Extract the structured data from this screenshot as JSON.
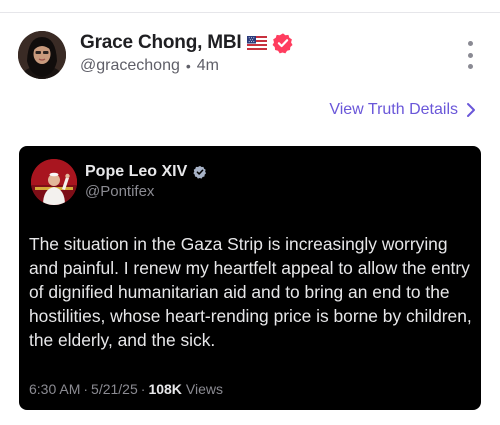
{
  "post": {
    "author_name": "Grace Chong, MBI",
    "flag_emoji": "us-flag-icon",
    "verified_icon": "verified-badge-icon",
    "handle": "@gracechong",
    "separator": "•",
    "age": "4m",
    "more_icon": "more-vertical-icon"
  },
  "truth_link": {
    "label": "View Truth Details",
    "icon": "chevron-right-icon",
    "color": "#6a57d9"
  },
  "embedded": {
    "author_name": "Pope Leo XIV",
    "handle": "@Pontifex",
    "verified_icon": "verified-badge-icon",
    "text": "The situation in the Gaza Strip is increasingly worrying and painful. I renew my heartfelt appeal to allow the entry of dignified humanitarian aid and to bring an end to the hostilities, whose heart-rending price is borne by children, the elderly, and the sick.",
    "time": "6:30 AM",
    "date": "5/21/25",
    "sep": "·",
    "views_count": "108K",
    "views_label": "Views"
  },
  "colors": {
    "verified": "#ff3d5f",
    "card_bg": "#000000",
    "accent": "#6a57d9"
  }
}
